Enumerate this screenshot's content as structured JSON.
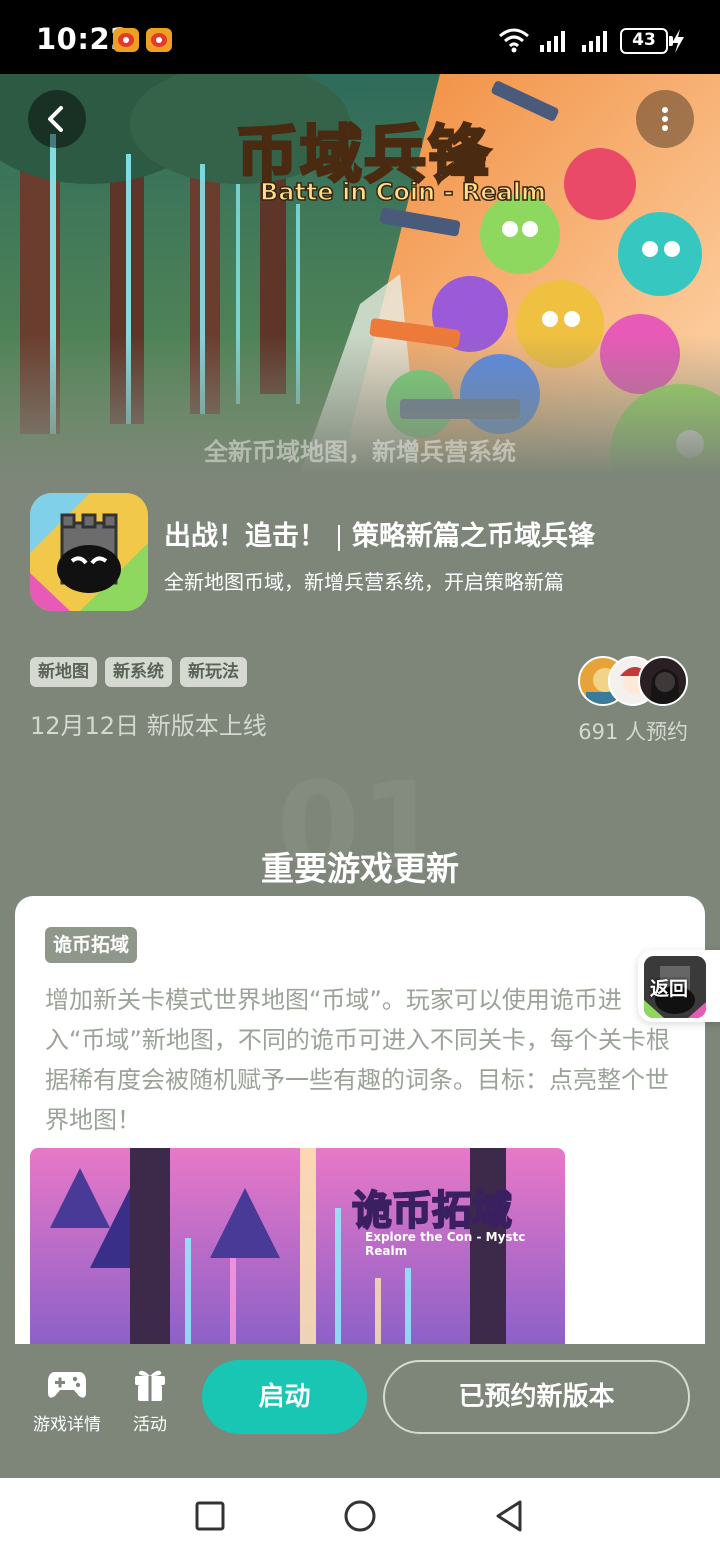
{
  "status_bar": {
    "time": "10:22",
    "battery": "43",
    "icons": [
      "weibo-notification-icon",
      "weibo-notification-icon",
      "wifi-icon",
      "signal-icon",
      "signal-icon",
      "battery-icon",
      "charging-bolt-icon"
    ]
  },
  "banner": {
    "title": "币域兵锋",
    "subtitle": "Batte in Coin - Realm",
    "caption": "全新币域地图，新增兵营系统",
    "back_icon": "chevron-left-icon",
    "more_icon": "more-vertical-icon"
  },
  "game": {
    "headline_left": "出战！追击！",
    "headline_right": "策略新篇之币域兵锋",
    "description": "全新地图币域，新增兵营系统，开启策略新篇",
    "tags": [
      "新地图",
      "新系统",
      "新玩法"
    ],
    "release": "12月12日 新版本上线",
    "reserve_count": "691 人预约"
  },
  "section": {
    "index": "01",
    "title": "重要游戏更新"
  },
  "update_card": {
    "tag": "诡币拓域",
    "text": "增加新关卡模式世界地图“币域”。玩家可以使用诡币进入“币域”新地图，不同的诡币可进入不同关卡，每个关卡根据稀有度会被随机赋予一些有趣的词条。目标：点亮整个世界地图！",
    "image_title": "诡币拓域",
    "image_subtitle": "Explore the Con - Mystc Realm"
  },
  "float_return": {
    "label": "返回"
  },
  "bottom_bar": {
    "details_label": "游戏详情",
    "activity_label": "活动",
    "launch_label": "启动",
    "reserved_label": "已预约新版本"
  },
  "nav_bar": {
    "icons": [
      "square-recents-icon",
      "circle-home-icon",
      "triangle-back-icon"
    ]
  },
  "colors": {
    "page_bg": "#7d8679",
    "accent": "#19c6b4",
    "card_bg": "#ffffff",
    "card_text": "#9ba399",
    "tag_bg": "#8e978a"
  }
}
